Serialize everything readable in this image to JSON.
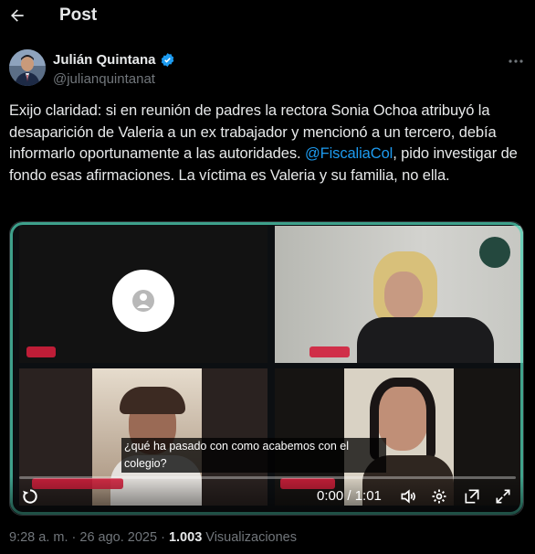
{
  "header": {
    "title": "Post"
  },
  "author": {
    "name": "Julián Quintana",
    "handle": "@julianquintanat",
    "verified_color": "#1d9bf0"
  },
  "tweet": {
    "text_before": "Exijo claridad: si en reunión de padres la rectora Sonia Ochoa atribuyó la desaparición de Valeria a un ex trabajador y mencionó a un tercero, debía informarlo oportunamente a las autoridades. ",
    "mention": "@FiscaliaCol",
    "text_after": ", pido investigar de fondo esas afirmaciones. La víctima es Valeria y su familia, no ella."
  },
  "video": {
    "caption": "¿qué ha pasado con como acabemos con el colegio?",
    "time": "0:00 / 1:01"
  },
  "meta": {
    "time": "9:28 a. m.",
    "separator1": "·",
    "date": "26 ago. 2025",
    "separator2": "·",
    "views_count": "1.003",
    "views_label": "Visualizaciones"
  },
  "colors": {
    "accent": "#1d9bf0",
    "text": "#e7e9ea",
    "muted": "#71767b",
    "bg": "#000000"
  }
}
